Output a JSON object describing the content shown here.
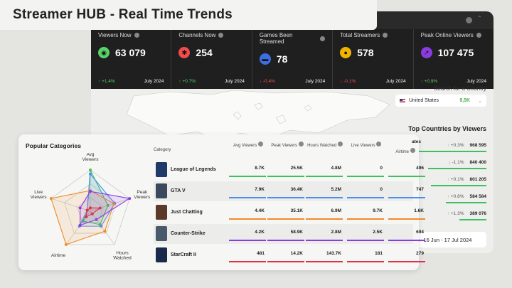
{
  "title": "Streamer HUB - Real Time Trends",
  "stats": [
    {
      "label": "Viewers Now",
      "value": "63 079",
      "change": "+1.4%",
      "dir": "up",
      "period": "July 2024",
      "icon": "eye-icon",
      "color": "#57d368",
      "glyph": "◉"
    },
    {
      "label": "Channels Now",
      "value": "254",
      "change": "+0.7%",
      "dir": "up",
      "period": "July 2024",
      "icon": "broadcast-icon",
      "color": "#f04c4c",
      "glyph": "✱"
    },
    {
      "label": "Games Been Streamed",
      "value": "78",
      "change": "-0.4%",
      "dir": "down",
      "period": "July 2024",
      "icon": "gamepad-icon",
      "color": "#3d6fe0",
      "glyph": "▬"
    },
    {
      "label": "Total Streamers",
      "value": "578",
      "change": "-0.1%",
      "dir": "down",
      "period": "July 2024",
      "icon": "users-icon",
      "color": "#f0b400",
      "glyph": "●"
    },
    {
      "label": "Peak Online Viewers",
      "value": "107 475",
      "change": "+0.9%",
      "dir": "up",
      "period": "July 2024",
      "icon": "trend-icon",
      "color": "#8a3ce0",
      "glyph": "↗"
    }
  ],
  "search": {
    "label": "Search for a Country",
    "country": "United States",
    "count": "9,5K"
  },
  "top_countries": {
    "title": "Top Countries by Viewers",
    "first_label": "ates",
    "rows": [
      {
        "change": "+0.3%",
        "dir": "up",
        "value": "968 595",
        "fill": 0.95
      },
      {
        "change": "-1.1%",
        "dir": "down",
        "value": "840 400",
        "fill": 0.82
      },
      {
        "change": "+0.1%",
        "dir": "up",
        "value": "801 205",
        "fill": 0.78
      },
      {
        "change": "+0.8%",
        "dir": "up",
        "value": "584 584",
        "fill": 0.57
      },
      {
        "change": "+1.3%",
        "dir": "up",
        "value": "389 076",
        "fill": 0.38
      }
    ]
  },
  "date_range": "16 Jun - 17 Jul 2024",
  "categories_card": {
    "title": "Popular Categories",
    "radar_axes": [
      "Avg Viewers",
      "Peak Viewers",
      "Hours Watched",
      "Airtime",
      "Live Viewers"
    ],
    "columns": {
      "category": "Category",
      "avg": "Avg Viewers",
      "peak": "Peak Viewers",
      "hours": "Hours Watched",
      "live": "Live Viewers",
      "airtime": "Airtime"
    },
    "rows": [
      {
        "name": "League of Legends",
        "avg": "8.7K",
        "peak": "25.5K",
        "hours": "4.8M",
        "live": "0",
        "airtime": "496",
        "color": "#3fc05e",
        "thumb": "#1e3a6b",
        "radar": [
          1.0,
          0.45,
          0.4,
          0.3,
          0.05
        ]
      },
      {
        "name": "GTA V",
        "avg": "7.9K",
        "peak": "36.4K",
        "hours": "5.2M",
        "live": "0",
        "airtime": "747",
        "color": "#4a8ff0",
        "thumb": "#3a4a5c",
        "radar": [
          0.9,
          0.62,
          0.45,
          0.45,
          0.05
        ]
      },
      {
        "name": "Just Chatting",
        "avg": "4.4K",
        "peak": "35.1K",
        "hours": "6.9M",
        "live": "9.7K",
        "airtime": "1.6K",
        "color": "#f08a2a",
        "thumb": "#5c3a2a",
        "radar": [
          0.5,
          0.6,
          0.6,
          1.0,
          1.0
        ]
      },
      {
        "name": "Counter-Strike",
        "avg": "4.2K",
        "peak": "58.9K",
        "hours": "2.8M",
        "live": "2.5K",
        "airtime": "694",
        "color": "#8a3ce0",
        "thumb": "#4a5a6a",
        "radar": [
          0.48,
          1.0,
          0.25,
          0.42,
          0.26
        ]
      },
      {
        "name": "StarCraft II",
        "avg": "481",
        "peak": "14.2K",
        "hours": "143.7K",
        "live": "181",
        "airtime": "279",
        "color": "#e0304a",
        "thumb": "#1a2a4a",
        "radar": [
          0.05,
          0.25,
          0.02,
          0.17,
          0.02
        ]
      }
    ]
  }
}
